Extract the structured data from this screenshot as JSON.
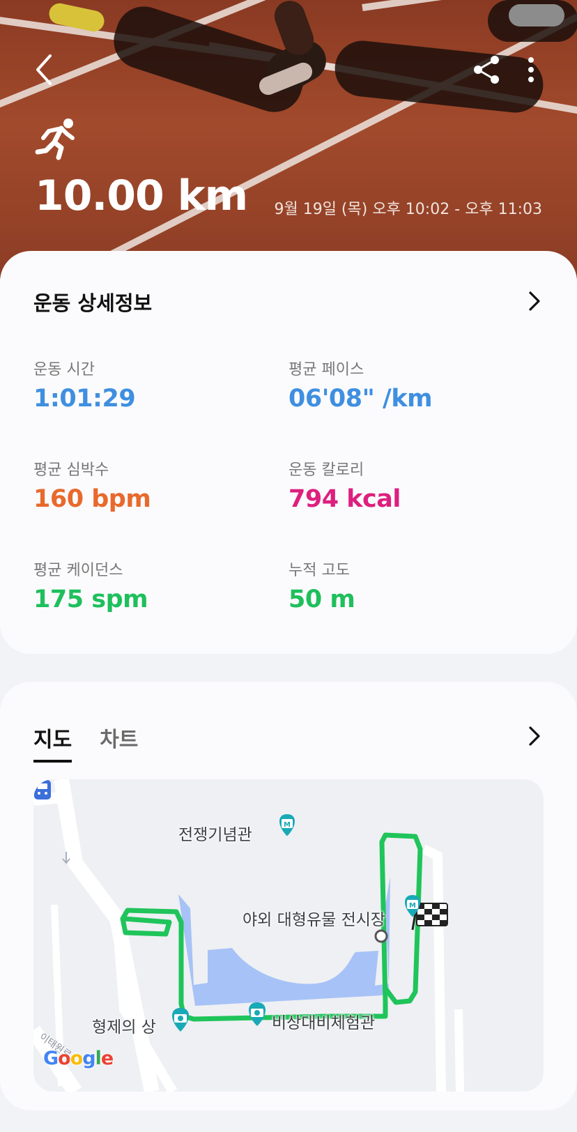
{
  "header": {
    "distance": "10.00 km",
    "datetime": "9월 19일 (목) 오후 10:02 - 오후 11:03",
    "icons": {
      "back": "back-arrow-icon",
      "share": "share-icon",
      "more": "more-vert-icon",
      "activity": "running-icon"
    }
  },
  "details": {
    "title": "운동 상세정보",
    "stats": [
      {
        "label": "운동 시간",
        "value": "1:01:29",
        "color": "#3f8fe0"
      },
      {
        "label": "평균 페이스",
        "value": "06'08\" /km",
        "color": "#3f8fe0"
      },
      {
        "label": "평균 심박수",
        "value": "160 bpm",
        "color": "#e8692c"
      },
      {
        "label": "운동 칼로리",
        "value": "794 kcal",
        "color": "#dd1f7e"
      },
      {
        "label": "평균 케이던스",
        "value": "175 spm",
        "color": "#1fbf5c"
      },
      {
        "label": "누적 고도",
        "value": "50 m",
        "color": "#1fbf5c"
      }
    ]
  },
  "map_section": {
    "tabs": [
      {
        "label": "지도",
        "active": true
      },
      {
        "label": "차트",
        "active": false
      }
    ],
    "map": {
      "places": {
        "war_memorial": "전쟁기념관",
        "outdoor_exhibit": "야외 대형유물 전시장",
        "brothers_statue": "형제의 상",
        "emergency_center": "비상대비체험관"
      },
      "road_label": "이태원로",
      "attribution": "Google",
      "route_color": "#1fc45a"
    }
  }
}
